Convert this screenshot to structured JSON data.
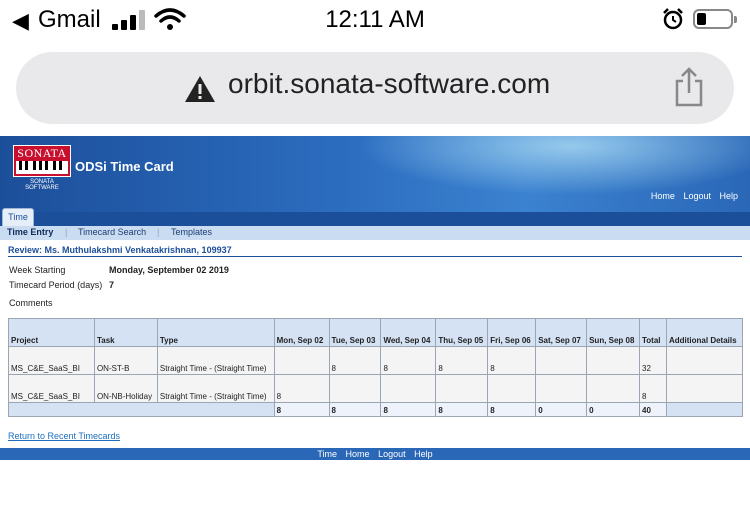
{
  "status_bar": {
    "back_app": "Gmail",
    "time": "12:11 AM"
  },
  "browser": {
    "url": "orbit.sonata-software.com"
  },
  "app": {
    "logo_text": "SONATA",
    "logo_subtext": "SONATA SOFTWARE",
    "title": "ODSi Time Card",
    "top_links": [
      "Home",
      "Logout",
      "Help"
    ]
  },
  "tabs": {
    "active": "Time"
  },
  "subnav": [
    "Time Entry",
    "Timecard Search",
    "Templates"
  ],
  "review": {
    "heading": "Review: Ms. Muthulakshmi Venkatakrishnan, 109937",
    "week_starting_label": "Week Starting",
    "week_starting_value": "Monday, September 02 2019",
    "period_label": "Timecard Period (days)",
    "period_value": "7",
    "comments_label": "Comments"
  },
  "table": {
    "headers": [
      "Project",
      "Task",
      "Type",
      "Mon, Sep 02",
      "Tue, Sep 03",
      "Wed, Sep 04",
      "Thu, Sep 05",
      "Fri, Sep 06",
      "Sat, Sep 07",
      "Sun, Sep 08",
      "Total",
      "Additional Details"
    ],
    "rows": [
      {
        "project": "MS_C&E_SaaS_BI",
        "task": "ON-ST-B",
        "type": "Straight Time - (Straight Time)",
        "days": [
          "",
          "8",
          "8",
          "8",
          "8",
          "",
          ""
        ],
        "total": "32",
        "details": ""
      },
      {
        "project": "MS_C&E_SaaS_BI",
        "task": "ON-NB-Holiday",
        "type": "Straight Time - (Straight Time)",
        "days": [
          "8",
          "",
          "",
          "",
          "",
          "",
          ""
        ],
        "total": "8",
        "details": ""
      }
    ],
    "totals": [
      "8",
      "8",
      "8",
      "8",
      "8",
      "0",
      "0"
    ],
    "grand_total": "40"
  },
  "return_link": "Return to Recent Timecards",
  "footer_links": [
    "Time",
    "Home",
    "Logout",
    "Help"
  ],
  "colors": {
    "header_blue": "#2c6cbf",
    "logo_red": "#c8102e",
    "link_blue": "#1c6fc0"
  }
}
